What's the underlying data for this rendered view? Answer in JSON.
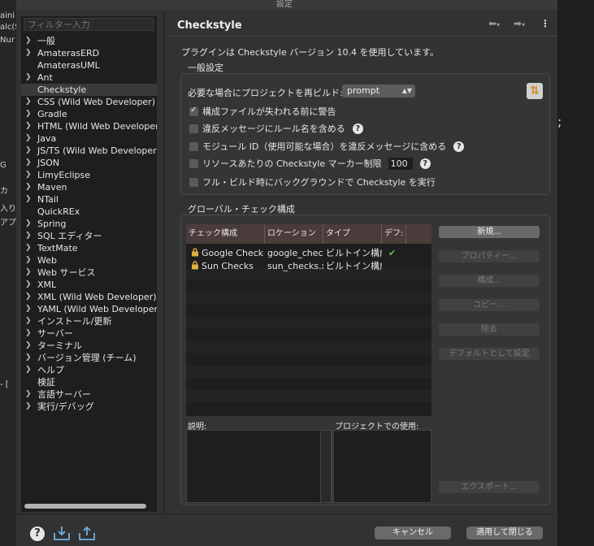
{
  "window": {
    "title": "設定"
  },
  "background": {
    "left_fragments": [
      "aini",
      "alc(S",
      "Nur",
      "G",
      "カ",
      "入り",
      "アプ",
      "- ["
    ],
    "right_fragment": ";"
  },
  "sidebar": {
    "filter_placeholder": "フィルター入力",
    "items": [
      {
        "label": "一般",
        "expandable": true
      },
      {
        "label": "AmaterasERD",
        "expandable": true
      },
      {
        "label": "AmaterasUML",
        "expandable": false
      },
      {
        "label": "Ant",
        "expandable": true
      },
      {
        "label": "Checkstyle",
        "expandable": false,
        "selected": true
      },
      {
        "label": "CSS (Wild Web Developer)",
        "expandable": true
      },
      {
        "label": "Gradle",
        "expandable": true
      },
      {
        "label": "HTML (Wild Web Developer)",
        "expandable": true
      },
      {
        "label": "Java",
        "expandable": true
      },
      {
        "label": "JS/TS (Wild Web Developer)",
        "expandable": true
      },
      {
        "label": "JSON",
        "expandable": true
      },
      {
        "label": "LimyEclipse",
        "expandable": true
      },
      {
        "label": "Maven",
        "expandable": true
      },
      {
        "label": "NTail",
        "expandable": true
      },
      {
        "label": "QuickREx",
        "expandable": false
      },
      {
        "label": "Spring",
        "expandable": true
      },
      {
        "label": "SQL エディター",
        "expandable": true
      },
      {
        "label": "TextMate",
        "expandable": true
      },
      {
        "label": "Web",
        "expandable": true
      },
      {
        "label": "Web サービス",
        "expandable": true
      },
      {
        "label": "XML",
        "expandable": true
      },
      {
        "label": "XML (Wild Web Developer)",
        "expandable": true
      },
      {
        "label": "YAML (Wild Web Developer)",
        "expandable": true
      },
      {
        "label": "インストール/更新",
        "expandable": true
      },
      {
        "label": "サーバー",
        "expandable": true
      },
      {
        "label": "ターミナル",
        "expandable": true
      },
      {
        "label": "バージョン管理 (チーム)",
        "expandable": true
      },
      {
        "label": "ヘルプ",
        "expandable": true
      },
      {
        "label": "検証",
        "expandable": false
      },
      {
        "label": "言語サーバー",
        "expandable": true
      },
      {
        "label": "実行/デバッグ",
        "expandable": true
      }
    ]
  },
  "page": {
    "title": "Checkstyle",
    "info": "プラグインは Checkstyle バージョン 10.4 を使用しています。"
  },
  "general": {
    "label": "一般設定",
    "rebuild_label": "必要な場合にプロジェクトを再ビルド:",
    "rebuild_value": "prompt",
    "checkboxes": [
      {
        "label": "構成ファイルが失われる前に警告",
        "checked": true,
        "help": false
      },
      {
        "label": "違反メッセージにルール名を含める",
        "checked": false,
        "help": true
      },
      {
        "label": "モジュール ID（使用可能な場合）を違反メッセージに含める",
        "checked": false,
        "help": true
      },
      {
        "label": "リソースあたりの Checkstyle マーカー制限",
        "checked": false,
        "help": true,
        "value": "100"
      },
      {
        "label": "フル・ビルド時にバックグラウンドで Checkstyle を実行",
        "checked": false,
        "help": false
      }
    ]
  },
  "global": {
    "label": "グローバル・チェック構成",
    "columns": [
      "チェック構成",
      "ロケーション",
      "タイプ",
      "デフ:"
    ],
    "rows": [
      {
        "name": "Google Check",
        "location": "google_check",
        "type": "ビルトイン構成",
        "default": true
      },
      {
        "name": "Sun Checks",
        "location": "sun_checks.x",
        "type": "ビルトイン構成",
        "default": false
      }
    ],
    "description_label": "説明:",
    "usage_label": "プロジェクトでの使用:",
    "buttons": {
      "new": "新規...",
      "properties": "プロパティー...",
      "configure": "構成...",
      "copy": "コピー...",
      "remove": "除去",
      "set_default": "デフォルトとして設定",
      "export": "エクスポート..."
    }
  },
  "footer": {
    "cancel": "キャンセル",
    "apply_close": "適用して閉じる"
  },
  "colors": {
    "accent_check": "#5cc24a",
    "header_bg": "#4a3c3a"
  }
}
